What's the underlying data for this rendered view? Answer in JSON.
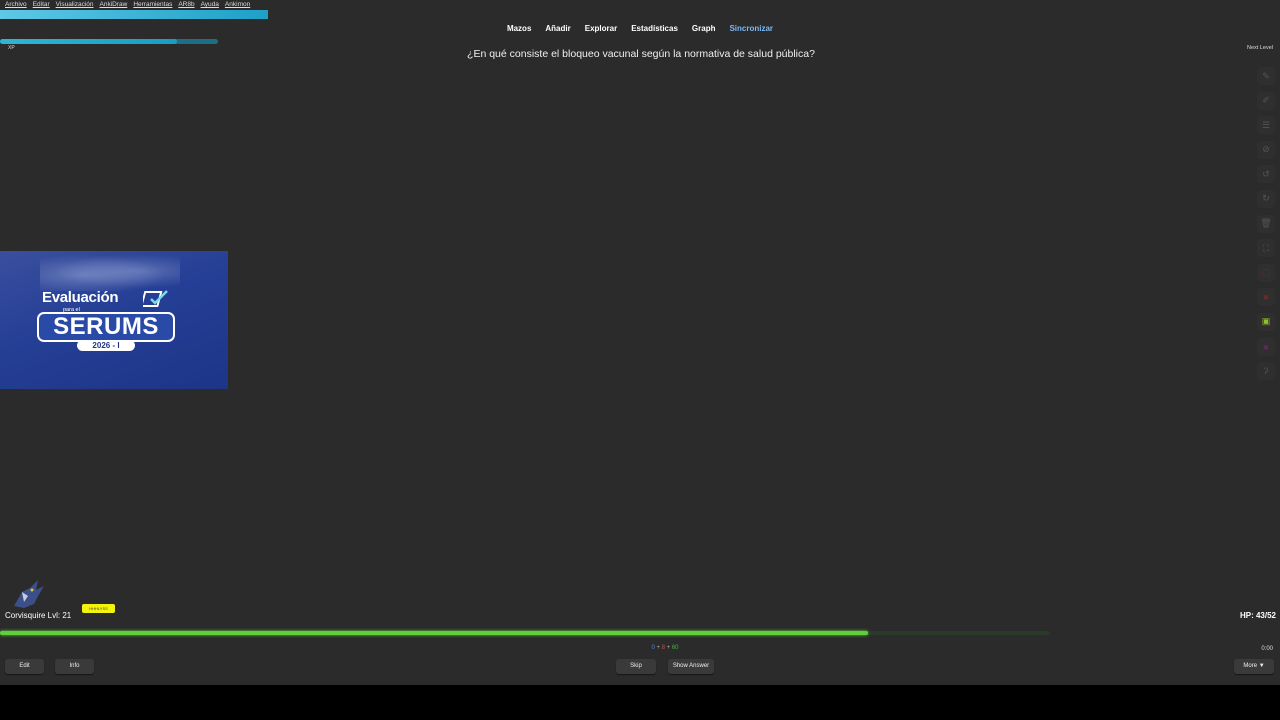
{
  "menubar": {
    "items": [
      "Archivo",
      "Editar",
      "Visualización",
      "AnkiDraw",
      "Herramientas",
      "AR8b",
      "Ayuda",
      "Ankimon"
    ]
  },
  "xp": {
    "label": "XP",
    "progress_percent": 0.81
  },
  "toplinks": [
    "Mazos",
    "Añadir",
    "Explorar",
    "Estadísticas",
    "Graph",
    "Sincronizar"
  ],
  "card": {
    "question": "¿En qué consiste el bloqueo vacunal según la normativa de salud pública?"
  },
  "next_level": "Next Level",
  "tools": [
    "pencil-icon",
    "pen-icon",
    "list-icon",
    "eye-off-icon",
    "undo-icon",
    "redo-icon",
    "trash-icon",
    "fullscreen-icon",
    "red-color-icon",
    "red-fill-icon",
    "green-color-icon",
    "purple-color-icon",
    "ear-icon"
  ],
  "banner": {
    "line1": "Evaluación",
    "line2": "para el",
    "line3": "SERUMS",
    "line4": "2026 - I"
  },
  "pokemon": {
    "name": "Corvisquire Lvl: 21",
    "badge": "HHHLYSS",
    "hp": "HP: 43/52",
    "hp_fraction": 0.827
  },
  "counts": {
    "new": "0",
    "sep1": " + ",
    "learn": "8",
    "sep2": " + ",
    "review": "60"
  },
  "timer": "0:00",
  "buttons": {
    "edit": "Edit",
    "info": "Info",
    "skip": "Skip",
    "show_answer": "Show Answer",
    "more": "More ▼"
  },
  "colors": {
    "background": "#2b2b2b",
    "accent_blue": "#2fb5d6",
    "hp_green": "#5fd03a",
    "sync_link": "#7ab8f5"
  }
}
